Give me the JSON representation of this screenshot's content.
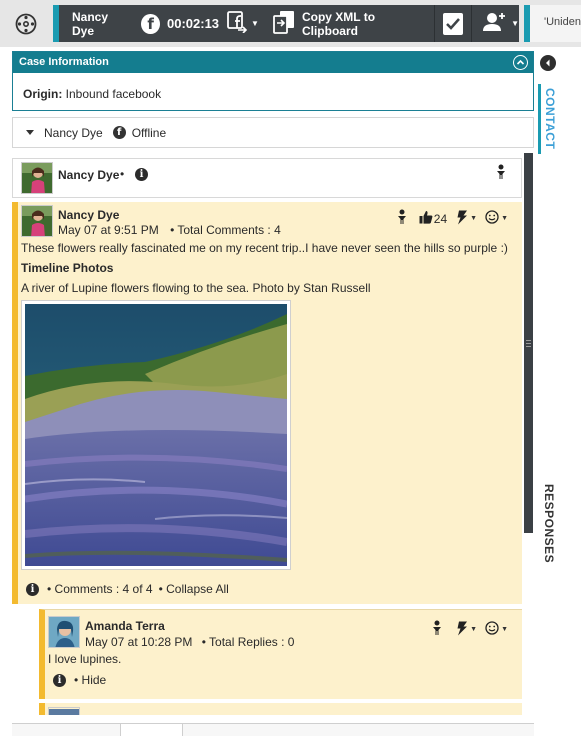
{
  "topbar": {
    "home_icon": "interaction-home-icon",
    "contact_name": "Nancy Dye",
    "channel_icon": "facebook-icon",
    "channel_glyph": "f",
    "timer": "00:02:13",
    "transfer_icon": "facebook-transfer-icon",
    "copy_xml_icon": "copy-xml-icon",
    "copy_xml_label": "Copy XML to Clipboard",
    "done_icon": "checkmark-icon",
    "party_icon": "party-action-icon",
    "next_tab_label": "'Uniden"
  },
  "case_info": {
    "header": "Case Information",
    "origin_label": "Origin:",
    "origin_value": "Inbound facebook"
  },
  "rail": {
    "contact_label": "CONTACT",
    "responses_label": "RESPONSES"
  },
  "contact": {
    "name": "Nancy Dye",
    "channel_glyph": "f",
    "status": "Offline"
  },
  "page_header": {
    "name": "Nancy Dye",
    "separator": "•"
  },
  "post": {
    "author": "Nancy Dye",
    "date": "May 07 at 9:51 PM",
    "comments_summary": "• Total Comments :  4",
    "likes": "24",
    "text": "These flowers really fascinated me on my recent trip..I have never seen the hills so purple :)",
    "subtitle": "Timeline Photos",
    "caption": "A river of Lupine flowers flowing to the sea. Photo by Stan Russell",
    "comments_counter": "• Comments :  4 of 4",
    "collapse_label": "• Collapse All",
    "photo_subject": "lupine-hillside-photo"
  },
  "reply": {
    "author": "Amanda Terra",
    "date": "May 07 at 10:28 PM",
    "replies_summary": "• Total Replies :  0",
    "text": "I love lupines.",
    "hide_label": "• Hide"
  },
  "colors": {
    "accent_teal": "#1a9bb1",
    "case_header": "#147d8f",
    "post_background": "#fdf1cc",
    "post_border": "#f3ba2f",
    "topbar_dark": "#3e4347"
  }
}
